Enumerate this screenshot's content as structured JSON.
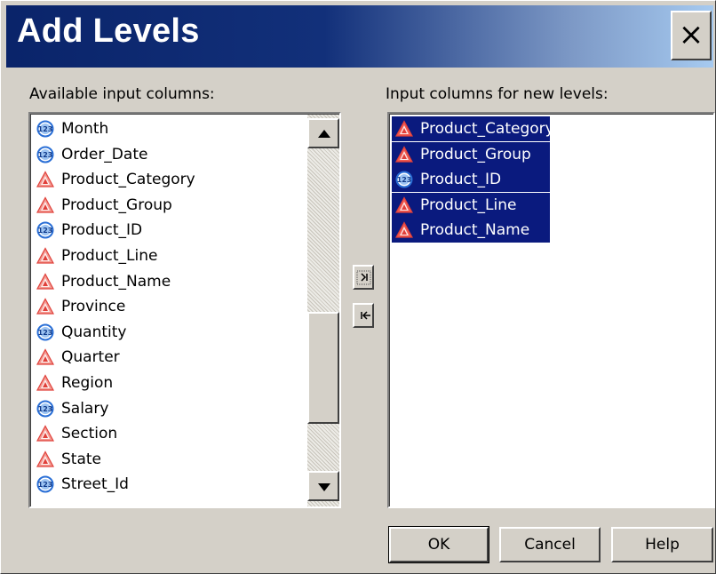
{
  "dialog": {
    "title": "Add Levels",
    "close_glyph": "×"
  },
  "available": {
    "label": "Available input columns:",
    "items": [
      {
        "label": "Month",
        "type": "numeric"
      },
      {
        "label": "Order_Date",
        "type": "numeric"
      },
      {
        "label": "Product_Category",
        "type": "character"
      },
      {
        "label": "Product_Group",
        "type": "character"
      },
      {
        "label": "Product_ID",
        "type": "numeric"
      },
      {
        "label": "Product_Line",
        "type": "character"
      },
      {
        "label": "Product_Name",
        "type": "character"
      },
      {
        "label": "Province",
        "type": "character"
      },
      {
        "label": "Quantity",
        "type": "numeric"
      },
      {
        "label": "Quarter",
        "type": "character"
      },
      {
        "label": "Region",
        "type": "character"
      },
      {
        "label": "Salary",
        "type": "numeric"
      },
      {
        "label": "Section",
        "type": "character"
      },
      {
        "label": "State",
        "type": "character"
      },
      {
        "label": "Street_Id",
        "type": "numeric"
      }
    ]
  },
  "selected": {
    "label": "Input columns for new levels:",
    "items": [
      {
        "label": "Product_Category",
        "type": "character"
      },
      {
        "label": "Product_Group",
        "type": "character"
      },
      {
        "label": "Product_ID",
        "type": "numeric"
      },
      {
        "label": "Product_Line",
        "type": "character"
      },
      {
        "label": "Product_Name",
        "type": "character"
      }
    ]
  },
  "buttons": {
    "ok": "OK",
    "cancel": "Cancel",
    "help": "Help"
  },
  "icons": {
    "numeric": "numeric-column-icon",
    "character": "character-column-icon",
    "add": "add-arrow-icon",
    "remove": "remove-arrow-icon"
  },
  "colors": {
    "title_bar_start": "#0a246a",
    "title_bar_end": "#a6caf0",
    "selection": "#0a1a7e",
    "numeric_icon": "#2a6fd6",
    "character_icon": "#e0403a"
  }
}
